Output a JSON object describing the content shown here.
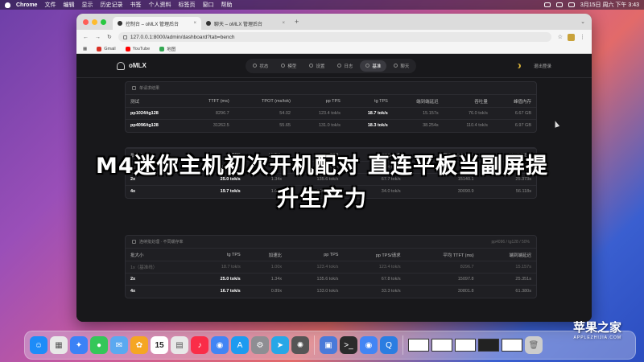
{
  "menubar": {
    "app": "Chrome",
    "items": [
      "文件",
      "编辑",
      "显示",
      "历史记录",
      "书签",
      "个人资料",
      "标签页",
      "窗口",
      "帮助"
    ],
    "datetime": "3月15日 周六 下午 3:43"
  },
  "browser": {
    "tabs": [
      {
        "label": "控制台 – oMLX 管理后台"
      },
      {
        "label": "聊天 – oMLX 管理后台"
      }
    ],
    "new_tab": "+",
    "url": "127.0.0.1:8000/admin/dashboard?tab=bench",
    "bookmarks": [
      {
        "label": "Gmail",
        "color": "#d93025"
      },
      {
        "label": "YouTube",
        "color": "#ff0000"
      },
      {
        "label": "地图",
        "color": "#34a853"
      }
    ]
  },
  "app": {
    "logo": "oMLX",
    "nav": [
      {
        "label": "状态",
        "active": false
      },
      {
        "label": "模型",
        "active": false
      },
      {
        "label": "设置",
        "active": false
      },
      {
        "label": "日志",
        "active": false
      },
      {
        "label": "基准",
        "active": true
      },
      {
        "label": "聊天",
        "active": false
      }
    ],
    "logout": "退出登录"
  },
  "card1": {
    "title": "单请求结果",
    "headers": [
      "测试",
      "TTFT (ms)",
      "TPOT (ms/tok)",
      "pp TPS",
      "tg TPS",
      "端到端延迟",
      "吞吐量",
      "峰值内存"
    ],
    "rows": [
      [
        "pp1024/tg128",
        "8296.7",
        "54.02",
        "123.4 tok/s",
        "18.7 tok/s",
        "15.157s",
        "76.0 tok/s",
        "6.67 GB"
      ],
      [
        "pp4096/tg128",
        "31262.5",
        "55.65",
        "131.0 tok/s",
        "18.3 tok/s",
        "38.254s",
        "110.4 tok/s",
        "6.97 GB"
      ]
    ]
  },
  "card2": {
    "headers": [
      "批大小",
      "tg TPS",
      "加速比",
      "pp TPS",
      "pp TPS/请求",
      "平均 TTFT (ms)",
      "端到端延迟"
    ],
    "rows": [
      [
        "1x（基准线）",
        "18.7 tok/s",
        "1.00x",
        "123.4 tok/s",
        "123.4 tok/s",
        "8296.7",
        "15.157s"
      ],
      [
        "2x",
        "25.0 tok/s",
        "1.34x",
        "135.6 tok/s",
        "67.7 tok/s",
        "15140.1",
        "25.373s"
      ],
      [
        "4x",
        "19.7 tok/s",
        "1.05x",
        "136.1 tok/s",
        "34.0 tok/s",
        "30090.9",
        "56.118s"
      ]
    ]
  },
  "card3": {
    "title": "连续批处理 · 不同缓存率",
    "subtitle": "pp4096 / tg128 / 50%",
    "headers": [
      "批大小",
      "tg TPS",
      "加速比",
      "pp TPS",
      "pp TPS/请求",
      "平均 TTFT (ms)",
      "端到端延迟"
    ],
    "rows": [
      [
        "1x（基准线）",
        "18.7 tok/s",
        "1.00x",
        "123.4 tok/s",
        "123.4 tok/s",
        "8296.7",
        "15.157s"
      ],
      [
        "2x",
        "25.0 tok/s",
        "1.34x",
        "135.6 tok/s",
        "67.8 tok/s",
        "15097.8",
        "25.351s"
      ],
      [
        "4x",
        "16.7 tok/s",
        "0.89x",
        "133.0 tok/s",
        "33.3 tok/s",
        "30801.8",
        "61.380s"
      ]
    ]
  },
  "overlay": {
    "line1": "M4迷你主机初次开机配对 直连平板当副屏提",
    "line2": "升生产力"
  },
  "watermark": {
    "title": "苹果之家",
    "sub": "APPLEZHIJIA.COM"
  },
  "dock": {
    "calendar_day": "15",
    "colors": [
      "#1d8cf8",
      "#e8e8e8",
      "#3b82f6",
      "#34c759",
      "#5aa9f0",
      "#f5a623",
      "#ffffff",
      "#e8e8e8",
      "#fa2d48",
      "#4285f4",
      "#1d9bf0",
      "#8e8e93",
      "#27a7e7",
      "#555555",
      "#7a7a7a",
      "#4a7ad9",
      "#2b2b2b",
      "#4285f4",
      "#2a7de1"
    ]
  }
}
